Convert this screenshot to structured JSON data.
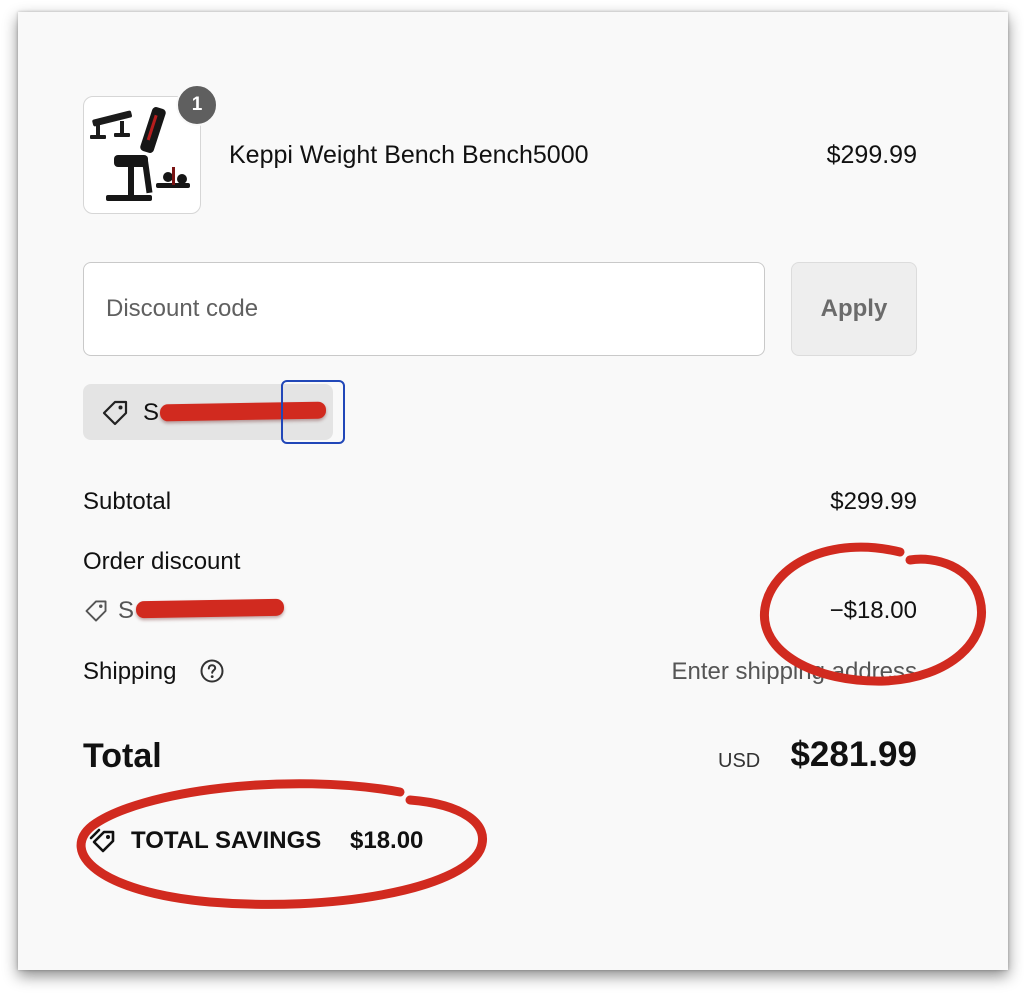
{
  "product": {
    "quantity_badge": "1",
    "name": "Keppi Weight Bench Bench5000",
    "price": "$299.99",
    "image_icon": "weight-bench-image"
  },
  "discount": {
    "placeholder": "Discount code",
    "apply_label": "Apply",
    "applied_code_visible": "S",
    "tag_icon": "tag-icon",
    "remove_icon": "remove-code-button"
  },
  "summary": {
    "subtotal_label": "Subtotal",
    "subtotal_value": "$299.99",
    "order_discount_label": "Order discount",
    "order_discount_code_visible": "S",
    "order_discount_value": "−$18.00",
    "shipping_label": "Shipping",
    "shipping_value": "Enter shipping address",
    "total_label": "Total",
    "currency": "USD",
    "total_value": "$281.99",
    "savings_label": "TOTAL SAVINGS",
    "savings_value": "$18.00"
  },
  "colors": {
    "annotation_red": "#d12a1f",
    "focus_blue": "#2147b8",
    "background": "#f9f9f9"
  }
}
